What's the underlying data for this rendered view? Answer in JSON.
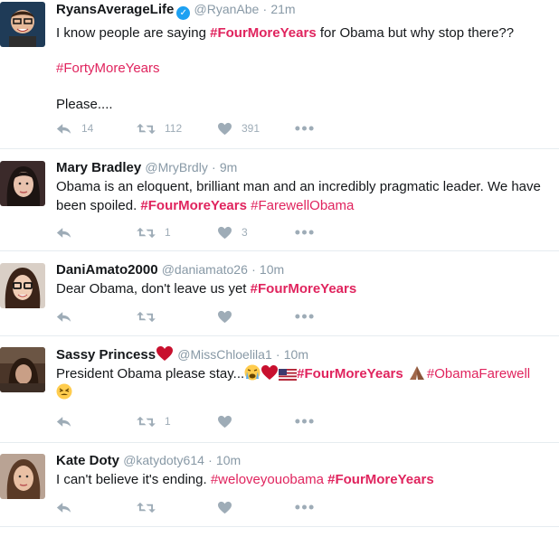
{
  "tweets": [
    {
      "name": "RyansAverageLife",
      "verified": true,
      "handle": "@RyanAbe",
      "time": "21m",
      "text_prefix": "I know people are saying ",
      "hashtag1": "#FourMoreYears",
      "text_mid": " for Obama but why stop there??",
      "hashtag2": "#FortyMoreYears",
      "text_tail": "Please....",
      "replies": "14",
      "retweets": "112",
      "likes": "391"
    },
    {
      "name": "Mary Bradley",
      "handle": "@MryBrdly",
      "time": "9m",
      "text": "Obama is an eloquent, brilliant man and an incredibly pragmatic leader. We have been spoiled. ",
      "hashtag1": "#FourMoreYears",
      "hashtag2": "#FarewellObama",
      "replies": "",
      "retweets": "1",
      "likes": "3"
    },
    {
      "name": "DaniAmato2000",
      "handle": "@daniamato26",
      "time": "10m",
      "text": "Dear Obama, don't leave us yet ",
      "hashtag1": "#FourMoreYears",
      "replies": "",
      "retweets": "",
      "likes": ""
    },
    {
      "name": "Sassy Princess",
      "handle": "@MissChloelila1",
      "time": "10m",
      "text": "President Obama please stay...",
      "hashtag1": "#FourMoreYears",
      "hashtag2": "#ObamaFarewell",
      "replies": "",
      "retweets": "1",
      "likes": ""
    },
    {
      "name": "Kate Doty",
      "handle": "@katydoty614",
      "time": "10m",
      "text": "I can't believe it's ending. ",
      "hashtag1": "#weloveyouobama",
      "hashtag2": "#FourMoreYears",
      "replies": "",
      "retweets": "",
      "likes": ""
    }
  ],
  "icons": {
    "reply": "reply-icon",
    "retweet": "retweet-icon",
    "like": "heart-icon",
    "more": "more-icon"
  },
  "colors": {
    "hashtag": "#e0245e",
    "meta": "#8899a6",
    "action": "#9eacb7",
    "verified": "#1da1f2"
  }
}
